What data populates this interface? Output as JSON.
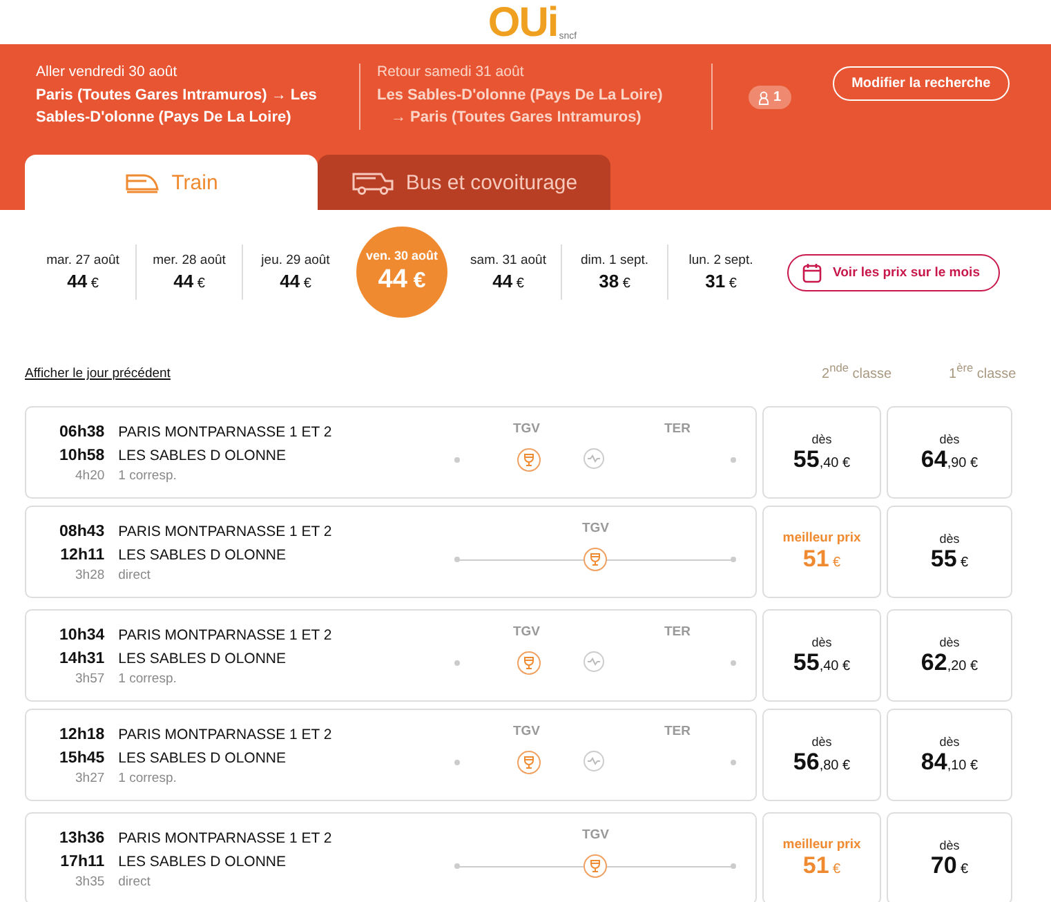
{
  "logo": {
    "text": "OUi",
    "sub": "sncf"
  },
  "outbound": {
    "title": "Aller vendredi 30 août",
    "route": "Paris (Toutes Gares Intramuros) → Les Sables-D'olonne (Pays De La Loire)"
  },
  "return": {
    "title": "Retour samedi 31 août",
    "route_from": "Les Sables-D'olonne (Pays De La Loire)",
    "route_to": "→ Paris (Toutes Gares Intramuros)"
  },
  "passengers": "1",
  "modify_button": "Modifier la recherche",
  "tabs": [
    {
      "label": "Train",
      "kind": "train",
      "selected": true
    },
    {
      "label": "Bus et covoiturage",
      "kind": "bus",
      "selected": false
    }
  ],
  "dates": [
    {
      "label": "mar. 27 août",
      "price": "44",
      "currency": "€",
      "selected": false
    },
    {
      "label": "mer. 28 août",
      "price": "44",
      "currency": "€",
      "selected": false
    },
    {
      "label": "jeu. 29 août",
      "price": "44",
      "currency": "€",
      "selected": false
    },
    {
      "label": "ven. 30 août",
      "price": "44",
      "currency": "€",
      "selected": true
    },
    {
      "label": "sam. 31 août",
      "price": "44",
      "currency": "€",
      "selected": false
    },
    {
      "label": "dim. 1 sept.",
      "price": "38",
      "currency": "€",
      "selected": false
    },
    {
      "label": "lun. 2 sept.",
      "price": "31",
      "currency": "€",
      "selected": false
    }
  ],
  "month_button": "Voir les prix sur le mois",
  "previous_day_link": "Afficher le jour précédent",
  "class_headers": [
    "2$^{nde}$ classe",
    "1$^{ère}$ classe"
  ],
  "journeys": [
    {
      "depart": "06h38",
      "arrive": "10h58",
      "duration": "4h20",
      "from": "PARIS MONTPARNASSE 1 ET 2",
      "to": "LES SABLES D OLONNE",
      "changes": "1 corresp.",
      "kind": "connection",
      "segments": [
        "TGV",
        "TER"
      ],
      "prices": [
        {
          "label": "dès",
          "amount": "55",
          "decimals": ",40",
          "currency": "€",
          "best": false
        },
        {
          "label": "dès",
          "amount": "64",
          "decimals": ",90",
          "currency": "€",
          "best": false
        }
      ]
    },
    {
      "depart": "08h43",
      "arrive": "12h11",
      "duration": "3h28",
      "from": "PARIS MONTPARNASSE 1 ET 2",
      "to": "LES SABLES D OLONNE",
      "changes": "direct",
      "kind": "direct",
      "segments": [
        "TGV"
      ],
      "prices": [
        {
          "label": "meilleur prix",
          "amount": "51",
          "currency": "€",
          "best": true
        },
        {
          "label": "dès",
          "amount": "55",
          "currency": "€",
          "best": false
        }
      ]
    },
    {
      "depart": "10h34",
      "arrive": "14h31",
      "duration": "3h57",
      "from": "PARIS MONTPARNASSE 1 ET 2",
      "to": "LES SABLES D OLONNE",
      "changes": "1 corresp.",
      "kind": "connection",
      "segments": [
        "TGV",
        "TER"
      ],
      "prices": [
        {
          "label": "dès",
          "amount": "55",
          "decimals": ",40",
          "currency": "€",
          "best": false
        },
        {
          "label": "dès",
          "amount": "62",
          "decimals": ",20",
          "currency": "€",
          "best": false
        }
      ]
    },
    {
      "depart": "12h18",
      "arrive": "15h45",
      "duration": "3h27",
      "from": "PARIS MONTPARNASSE 1 ET 2",
      "to": "LES SABLES D OLONNE",
      "changes": "1 corresp.",
      "kind": "connection",
      "segments": [
        "TGV",
        "TER"
      ],
      "prices": [
        {
          "label": "dès",
          "amount": "56",
          "decimals": ",80",
          "currency": "€",
          "best": false
        },
        {
          "label": "dès",
          "amount": "84",
          "decimals": ",10",
          "currency": "€",
          "best": false
        }
      ]
    },
    {
      "depart": "13h36",
      "arrive": "17h11",
      "duration": "3h35",
      "from": "PARIS MONTPARNASSE 1 ET 2",
      "to": "LES SABLES D OLONNE",
      "changes": "direct",
      "kind": "direct",
      "segments": [
        "TGV"
      ],
      "prices": [
        {
          "label": "meilleur prix",
          "amount": "51",
          "currency": "€",
          "best": true
        },
        {
          "label": "dès",
          "amount": "70",
          "currency": "€",
          "best": false
        }
      ]
    }
  ]
}
